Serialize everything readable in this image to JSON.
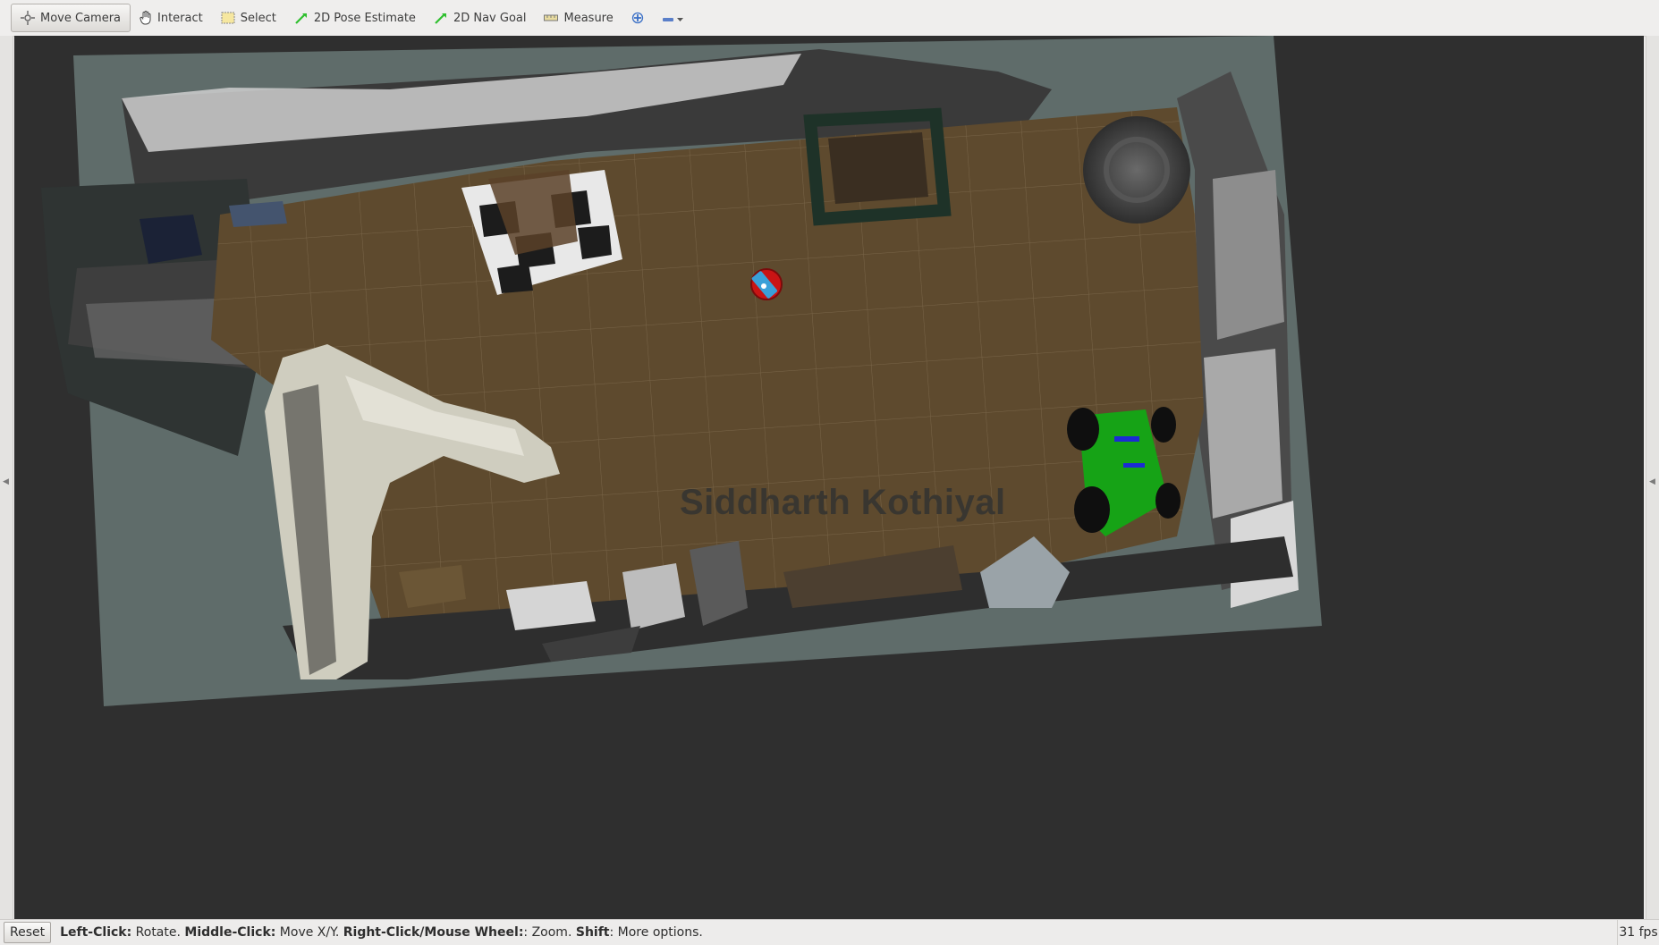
{
  "toolbar": {
    "items": [
      {
        "label": "Move Camera",
        "icon": "move-camera-icon"
      },
      {
        "label": "Interact",
        "icon": "hand-icon"
      },
      {
        "label": "Select",
        "icon": "select-box-icon"
      },
      {
        "label": "2D Pose Estimate",
        "icon": "green-arrow-icon"
      },
      {
        "label": "2D Nav Goal",
        "icon": "green-arrow-icon"
      },
      {
        "label": "Measure",
        "icon": "ruler-icon"
      }
    ],
    "add_tool_icon": "plus-icon",
    "remove_tool_icon": "minus-icon"
  },
  "viewport": {
    "watermark": "Siddharth Kothiyal"
  },
  "statusbar": {
    "reset_label": "Reset",
    "hint_parts": [
      {
        "bold": "Left-Click:",
        "text": " Rotate. "
      },
      {
        "bold": "Middle-Click:",
        "text": " Move X/Y. "
      },
      {
        "bold": "Right-Click/Mouse Wheel:",
        "text": ": Zoom. "
      },
      {
        "bold": "Shift",
        "text": ": More options."
      }
    ],
    "fps": "31 fps"
  },
  "colors": {
    "floor": "#5e4a2e",
    "ground_plane": "#5f6c6a",
    "background": "#2f2f2f",
    "robot": "#c91414"
  }
}
